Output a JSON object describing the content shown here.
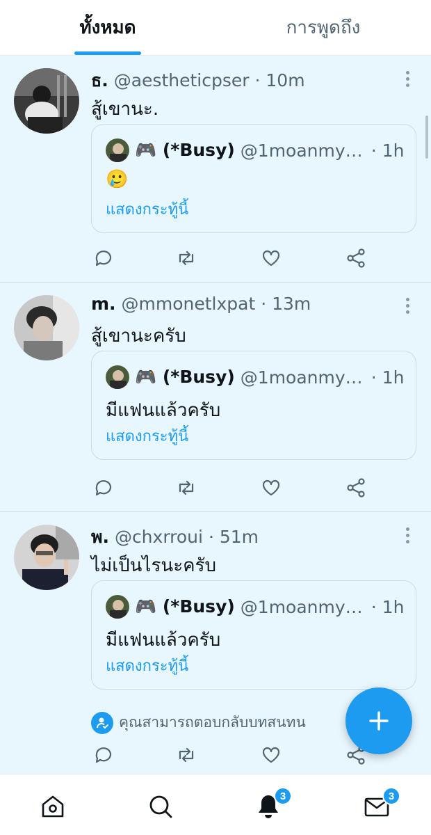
{
  "tabs": [
    {
      "label": "ทั้งหมด",
      "active": true
    },
    {
      "label": "การพูดถึง",
      "active": false
    }
  ],
  "tweets": [
    {
      "display_name": "ธ.",
      "handle": "@aestheticpser",
      "time": "· 10m",
      "text": "สู้เขานะ.",
      "quote": {
        "display_name": "🎮 (*Busy)",
        "handle": "@1moanmyn...",
        "time": "· 1h",
        "text": "🥲",
        "link": "แสดงกระทู้นี้"
      }
    },
    {
      "display_name": "m.",
      "handle": "@mmonetlxpat",
      "time": "· 13m",
      "text": "สู้เขานะครับ",
      "quote": {
        "display_name": "🎮 (*Busy)",
        "handle": "@1moanmyn...",
        "time": "· 1h",
        "text": "มีแฟนแล้วครับ",
        "link": "แสดงกระทู้นี้"
      }
    },
    {
      "display_name": "พ.",
      "handle": "@chxrroui",
      "time": "· 51m",
      "text": "ไม่เป็นไรนะครับ",
      "quote": {
        "display_name": "🎮 (*Busy)",
        "handle": "@1moanmyn...",
        "time": "· 1h",
        "text": "มีแฟนแล้วครับ",
        "link": "แสดงกระทู้นี้"
      },
      "reply_note": "คุณสามารถตอบกลับบทสนทน"
    }
  ],
  "bottom_nav": [
    {
      "icon": "home-icon"
    },
    {
      "icon": "search-icon"
    },
    {
      "icon": "bell-icon",
      "badge": "3"
    },
    {
      "icon": "mail-icon",
      "badge": "3"
    }
  ],
  "colors": {
    "accent": "#1d9bf0",
    "feed_bg": "#e8f6fe",
    "text": "#0f1419",
    "muted": "#536471"
  }
}
